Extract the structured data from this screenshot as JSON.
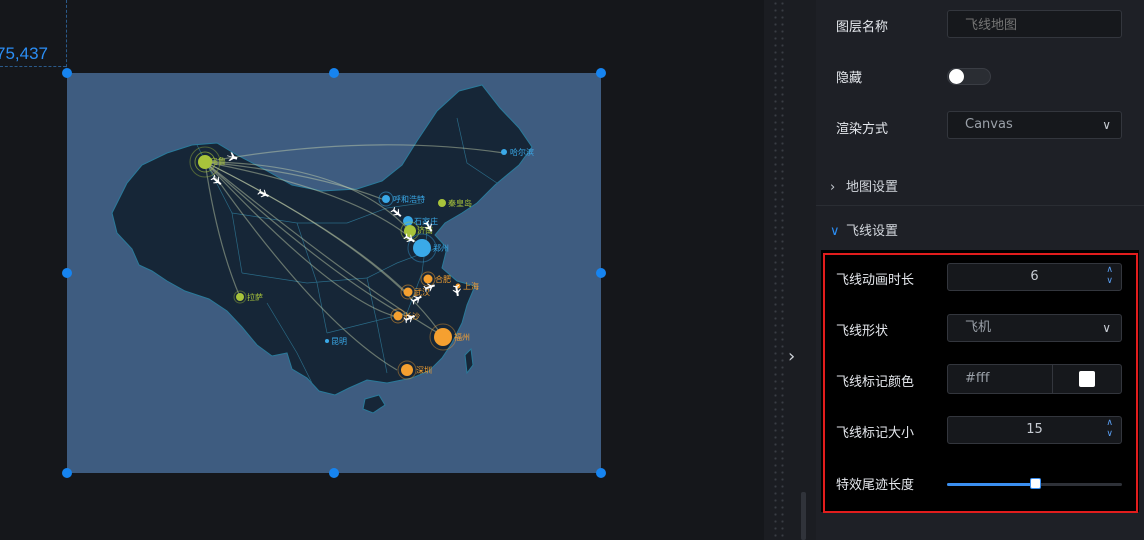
{
  "canvas": {
    "coord_readout": "75,437",
    "map_component": {
      "cities": [
        {
          "name": "乌鲁木齐",
          "short": "乌鲁",
          "color": "#a8c43b"
        },
        {
          "name": "哈尔滨",
          "short": "哈尔滨",
          "color": "#3aa9e8"
        },
        {
          "name": "呼和浩特",
          "short": "呼和浩特",
          "color": "#3aa9e8"
        },
        {
          "name": "秦皇岛",
          "short": "秦皇岛",
          "color": "#a8c43b"
        },
        {
          "name": "石家庄",
          "short": "石家庄",
          "color": "#3aa9e8"
        },
        {
          "name": "济南",
          "short": "济南",
          "color": "#a8c43b"
        },
        {
          "name": "郑州",
          "short": "郑州",
          "color": "#3aa9e8"
        },
        {
          "name": "拉萨",
          "short": "拉萨",
          "color": "#a8c43b"
        },
        {
          "name": "合肥",
          "short": "合肥",
          "color": "#f5a030"
        },
        {
          "name": "上海",
          "short": "上海",
          "color": "#f5a030"
        },
        {
          "name": "武汉",
          "short": "武汉",
          "color": "#f5a030"
        },
        {
          "name": "长沙",
          "short": "长沙",
          "color": "#f5a030"
        },
        {
          "name": "福州",
          "short": "福州",
          "color": "#f5a030"
        },
        {
          "name": "昆明",
          "short": "昆明",
          "color": "#3aa9e8"
        },
        {
          "name": "深圳",
          "short": "深圳",
          "color": "#f5a030"
        }
      ]
    }
  },
  "panel": {
    "layer_name_label": "图层名称",
    "layer_name_placeholder": "飞线地图",
    "hidden_label": "隐藏",
    "hidden_value": false,
    "render_label": "渲染方式",
    "render_value": "Canvas",
    "map_settings_label": "地图设置",
    "fly_settings_label": "飞线设置",
    "fly_duration_label": "飞线动画时长",
    "fly_duration_value": "6",
    "fly_shape_label": "飞线形状",
    "fly_shape_value": "飞机",
    "marker_color_label": "飞线标记颜色",
    "marker_color_value": "#fff",
    "marker_size_label": "飞线标记大小",
    "marker_size_value": "15",
    "trail_length_label": "特效尾迹长度",
    "trail_length_fraction": 0.5
  },
  "colors": {
    "accent": "#1684f0",
    "highlight_border": "#e21d1d",
    "map_background": "#3e5c80",
    "map_land": "#162637"
  },
  "icons": {
    "collapse": "chevron-right-icon",
    "dropdown": "chevron-down-icon",
    "section_closed": "chevron-right-icon",
    "section_open": "chevron-down-icon",
    "stepper": "spin-up-down-icon",
    "flight_marker": "airplane-icon"
  }
}
